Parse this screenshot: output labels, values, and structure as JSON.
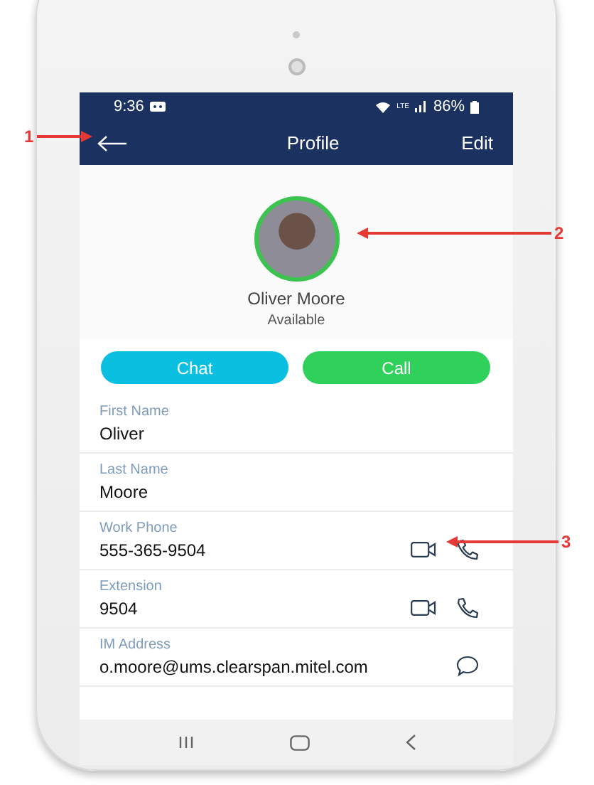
{
  "status_bar": {
    "time": "9:36",
    "network": "LTE",
    "battery": "86%"
  },
  "header": {
    "title": "Profile",
    "action": "Edit"
  },
  "profile": {
    "name": "Oliver Moore",
    "presence": "Available"
  },
  "buttons": [
    {
      "label": "Chat",
      "color": "#0bbfe0"
    },
    {
      "label": "Call",
      "color": "#30d15a"
    }
  ],
  "fields": [
    {
      "label": "First Name",
      "value": "Oliver"
    },
    {
      "label": "Last Name",
      "value": "Moore"
    },
    {
      "label": "Work Phone",
      "value": "555-365-9504",
      "actions": [
        {
          "kind": "video"
        },
        {
          "kind": "phone"
        }
      ]
    },
    {
      "label": "Extension",
      "value": "9504",
      "actions": [
        {
          "kind": "video"
        },
        {
          "kind": "phone"
        }
      ]
    },
    {
      "label": "IM Address",
      "value": "o.moore@ums.clearspan.mitel.com",
      "actions": [
        {
          "kind": "chat"
        }
      ]
    }
  ],
  "callouts": [
    {
      "label": "1"
    },
    {
      "label": "2"
    },
    {
      "label": "3"
    }
  ]
}
